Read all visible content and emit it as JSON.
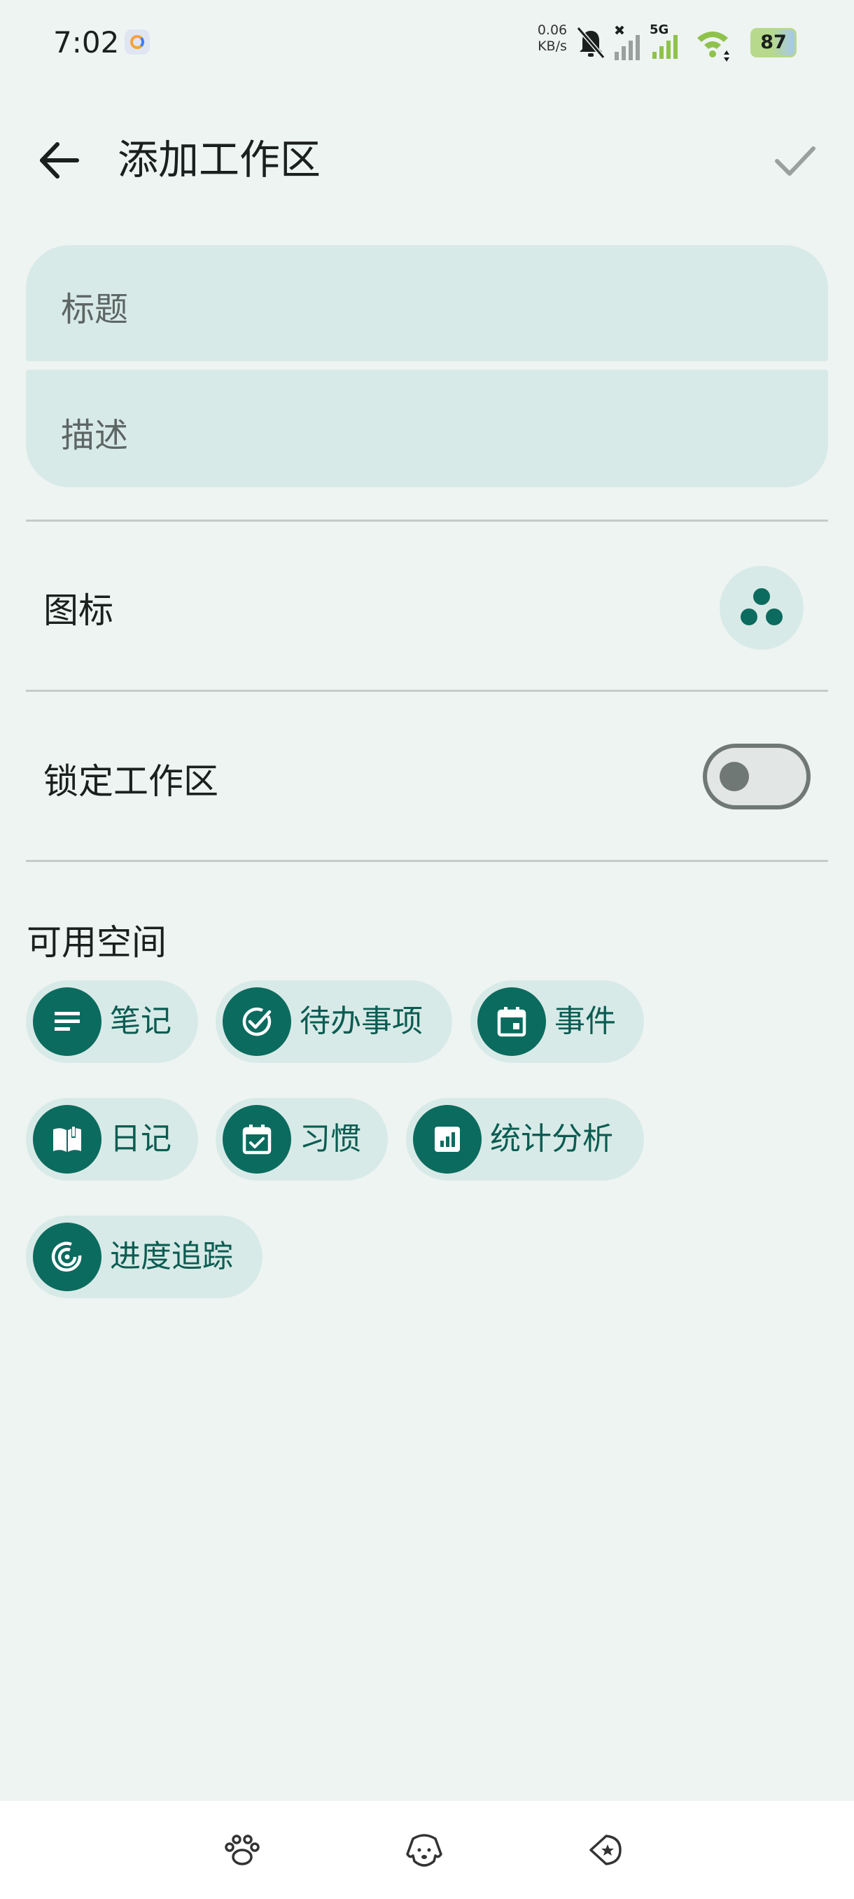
{
  "status_bar": {
    "time": "7:02",
    "net_speed_value": "0.06",
    "net_speed_unit": "KB/s",
    "network_type": "5G",
    "battery": "87"
  },
  "app_bar": {
    "title": "添加工作区",
    "back_icon": "arrow-left-icon",
    "confirm_icon": "check-icon"
  },
  "form": {
    "title_placeholder": "标题",
    "description_placeholder": "描述",
    "icon_label": "图标",
    "icon_value": "three-dots-icon",
    "lock_label": "锁定工作区",
    "lock_enabled": false
  },
  "spaces": {
    "section_title": "可用空间",
    "chips": [
      {
        "label": "笔记",
        "icon": "notes-icon"
      },
      {
        "label": "待办事项",
        "icon": "check-circle-icon"
      },
      {
        "label": "事件",
        "icon": "calendar-event-icon"
      },
      {
        "label": "日记",
        "icon": "book-icon"
      },
      {
        "label": "习惯",
        "icon": "calendar-check-icon"
      },
      {
        "label": "统计分析",
        "icon": "bar-chart-icon"
      },
      {
        "label": "进度追踪",
        "icon": "target-icon"
      }
    ]
  },
  "bottom_nav": [
    "paw-icon",
    "dog-icon",
    "star-tag-icon"
  ],
  "colors": {
    "accent": "#0b6b5f",
    "surface": "#d8eae7",
    "background": "#eef4f2"
  }
}
